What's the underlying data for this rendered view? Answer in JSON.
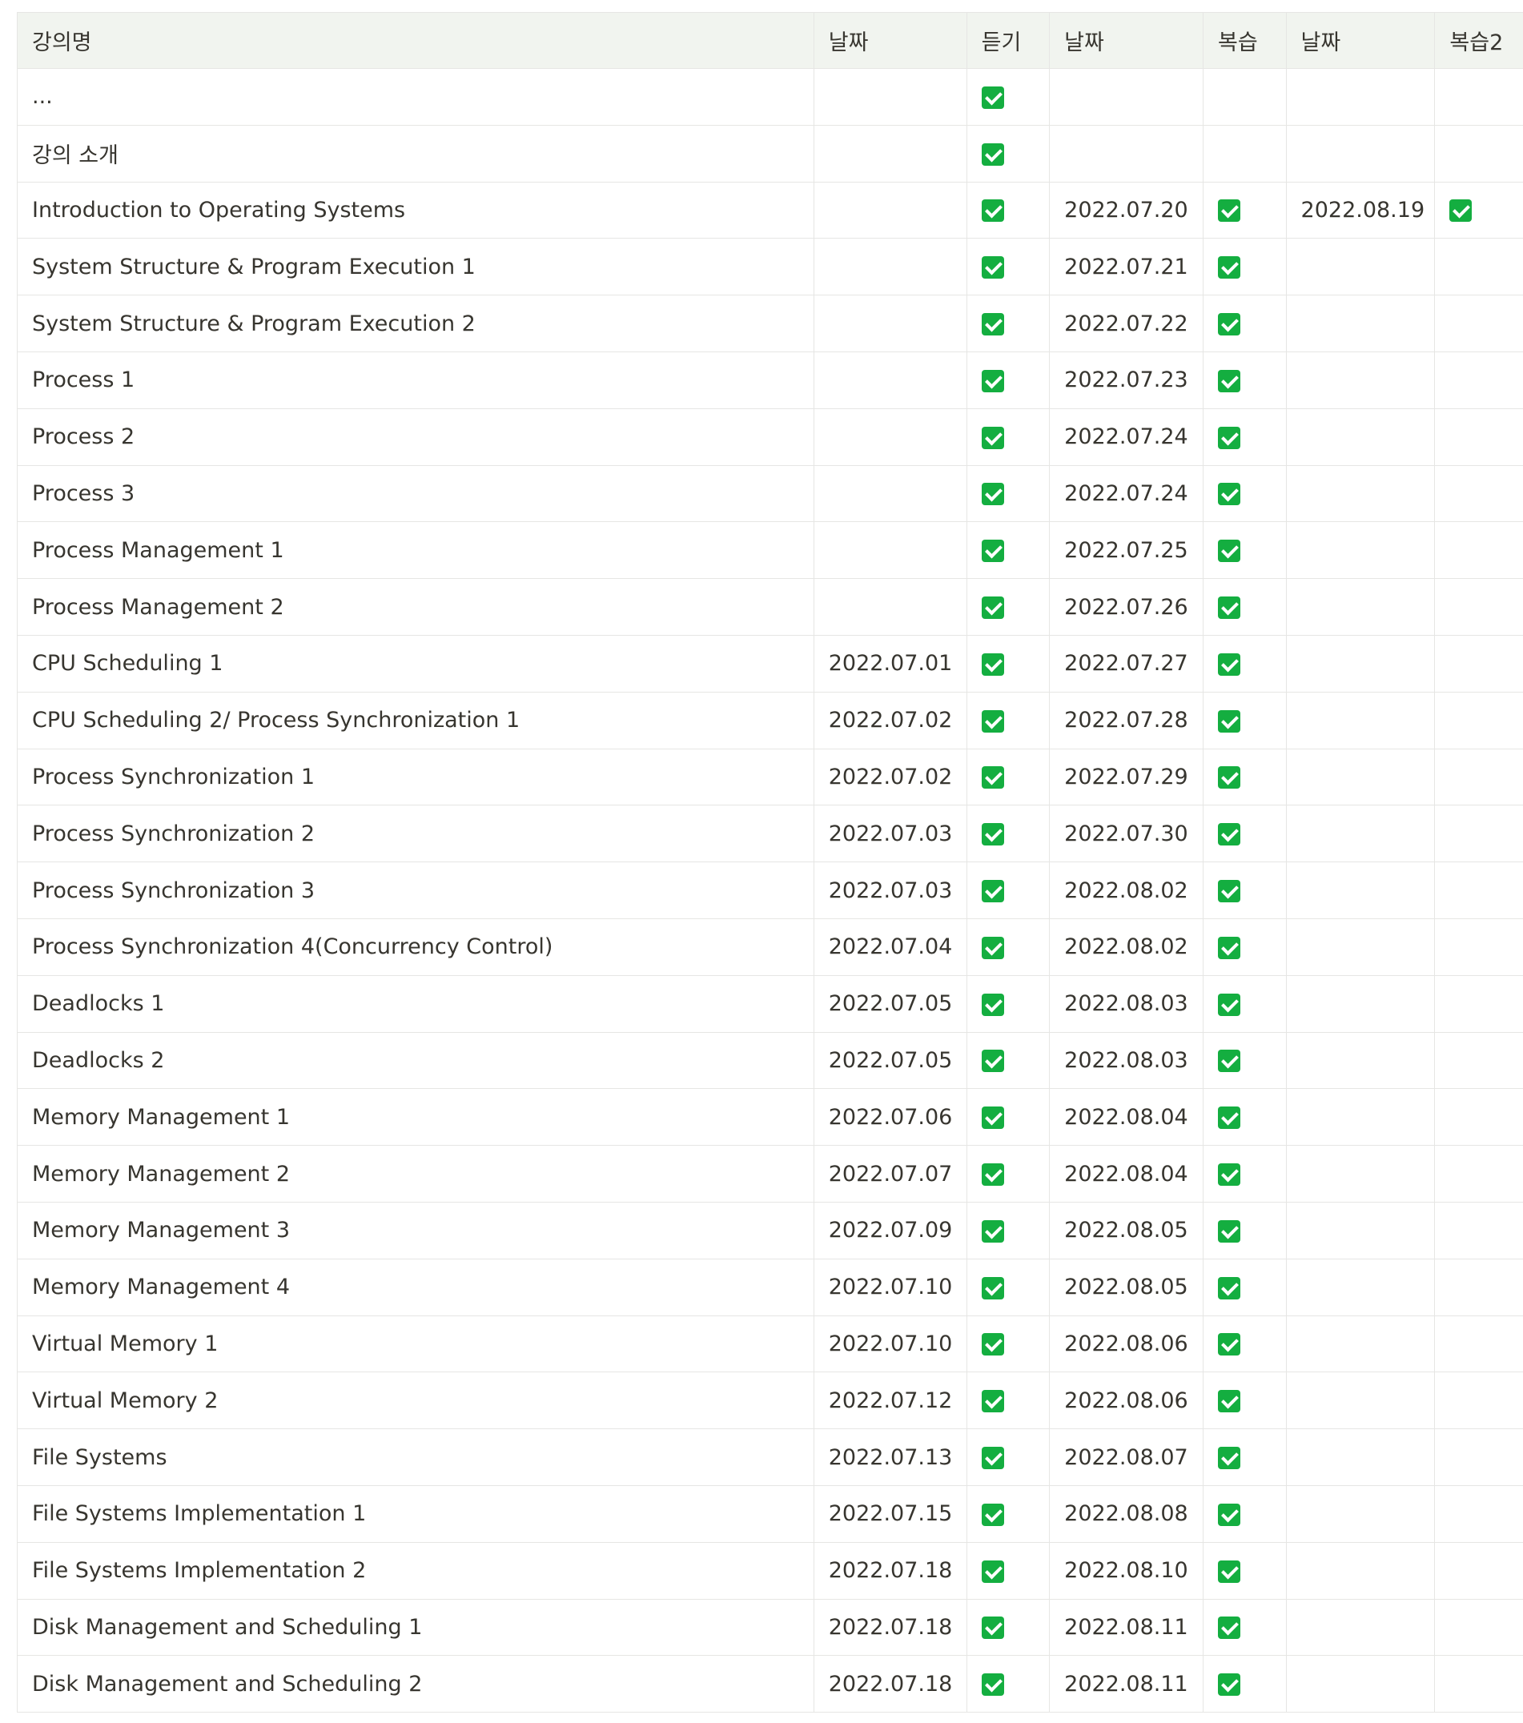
{
  "columns": {
    "lecture": "강의명",
    "date1": "날짜",
    "listen": "듣기",
    "date2": "날짜",
    "review": "복습",
    "date3": "날짜",
    "review2": "복습2"
  },
  "rows": [
    {
      "lecture": "...",
      "date1": "",
      "listen": true,
      "date2": "",
      "review": false,
      "date3": "",
      "review2": false
    },
    {
      "lecture": "강의 소개",
      "date1": "",
      "listen": true,
      "date2": "",
      "review": false,
      "date3": "",
      "review2": false
    },
    {
      "lecture": "Introduction to Operating Systems",
      "date1": "",
      "listen": true,
      "date2": "2022.07.20",
      "review": true,
      "date3": "2022.08.19",
      "review2": true
    },
    {
      "lecture": "System Structure & Program Execution 1",
      "date1": "",
      "listen": true,
      "date2": "2022.07.21",
      "review": true,
      "date3": "",
      "review2": false
    },
    {
      "lecture": "System Structure & Program Execution 2",
      "date1": "",
      "listen": true,
      "date2": "2022.07.22",
      "review": true,
      "date3": "",
      "review2": false
    },
    {
      "lecture": "Process 1",
      "date1": "",
      "listen": true,
      "date2": "2022.07.23",
      "review": true,
      "date3": "",
      "review2": false
    },
    {
      "lecture": "Process 2",
      "date1": "",
      "listen": true,
      "date2": "2022.07.24",
      "review": true,
      "date3": "",
      "review2": false
    },
    {
      "lecture": "Process 3",
      "date1": "",
      "listen": true,
      "date2": "2022.07.24",
      "review": true,
      "date3": "",
      "review2": false
    },
    {
      "lecture": "Process Management 1",
      "date1": "",
      "listen": true,
      "date2": "2022.07.25",
      "review": true,
      "date3": "",
      "review2": false
    },
    {
      "lecture": "Process Management 2",
      "date1": "",
      "listen": true,
      "date2": "2022.07.26",
      "review": true,
      "date3": "",
      "review2": false
    },
    {
      "lecture": "CPU Scheduling 1",
      "date1": "2022.07.01",
      "listen": true,
      "date2": "2022.07.27",
      "review": true,
      "date3": "",
      "review2": false
    },
    {
      "lecture": "CPU Scheduling 2/ Process Synchronization 1",
      "date1": "2022.07.02",
      "listen": true,
      "date2": "2022.07.28",
      "review": true,
      "date3": "",
      "review2": false
    },
    {
      "lecture": "Process Synchronization 1",
      "date1": "2022.07.02",
      "listen": true,
      "date2": "2022.07.29",
      "review": true,
      "date3": "",
      "review2": false
    },
    {
      "lecture": "Process Synchronization 2",
      "date1": "2022.07.03",
      "listen": true,
      "date2": "2022.07.30",
      "review": true,
      "date3": "",
      "review2": false
    },
    {
      "lecture": "Process Synchronization 3",
      "date1": "2022.07.03",
      "listen": true,
      "date2": "2022.08.02",
      "review": true,
      "date3": "",
      "review2": false
    },
    {
      "lecture": "Process Synchronization 4(Concurrency Control)",
      "date1": "2022.07.04",
      "listen": true,
      "date2": "2022.08.02",
      "review": true,
      "date3": "",
      "review2": false
    },
    {
      "lecture": "Deadlocks 1",
      "date1": "2022.07.05",
      "listen": true,
      "date2": "2022.08.03",
      "review": true,
      "date3": "",
      "review2": false
    },
    {
      "lecture": "Deadlocks 2",
      "date1": "2022.07.05",
      "listen": true,
      "date2": "2022.08.03",
      "review": true,
      "date3": "",
      "review2": false
    },
    {
      "lecture": "Memory Management 1",
      "date1": "2022.07.06",
      "listen": true,
      "date2": "2022.08.04",
      "review": true,
      "date3": "",
      "review2": false
    },
    {
      "lecture": "Memory Management 2",
      "date1": "2022.07.07",
      "listen": true,
      "date2": "2022.08.04",
      "review": true,
      "date3": "",
      "review2": false
    },
    {
      "lecture": "Memory Management 3",
      "date1": "2022.07.09",
      "listen": true,
      "date2": "2022.08.05",
      "review": true,
      "date3": "",
      "review2": false
    },
    {
      "lecture": "Memory Management 4",
      "date1": "2022.07.10",
      "listen": true,
      "date2": "2022.08.05",
      "review": true,
      "date3": "",
      "review2": false
    },
    {
      "lecture": "Virtual Memory 1",
      "date1": "2022.07.10",
      "listen": true,
      "date2": "2022.08.06",
      "review": true,
      "date3": "",
      "review2": false
    },
    {
      "lecture": "Virtual Memory 2",
      "date1": "2022.07.12",
      "listen": true,
      "date2": "2022.08.06",
      "review": true,
      "date3": "",
      "review2": false
    },
    {
      "lecture": "File Systems",
      "date1": "2022.07.13",
      "listen": true,
      "date2": "2022.08.07",
      "review": true,
      "date3": "",
      "review2": false
    },
    {
      "lecture": "File Systems Implementation 1",
      "date1": "2022.07.15",
      "listen": true,
      "date2": "2022.08.08",
      "review": true,
      "date3": "",
      "review2": false
    },
    {
      "lecture": "File Systems Implementation 2",
      "date1": "2022.07.18",
      "listen": true,
      "date2": "2022.08.10",
      "review": true,
      "date3": "",
      "review2": false
    },
    {
      "lecture": "Disk Management and Scheduling 1",
      "date1": "2022.07.18",
      "listen": true,
      "date2": "2022.08.11",
      "review": true,
      "date3": "",
      "review2": false
    },
    {
      "lecture": "Disk Management and Scheduling 2",
      "date1": "2022.07.18",
      "listen": true,
      "date2": "2022.08.11",
      "review": true,
      "date3": "",
      "review2": false
    }
  ],
  "icons": {
    "check": "check-box-icon"
  },
  "colors": {
    "header_bg": "#f1f4ef",
    "border": "#e6e6e4",
    "check_green": "#14ae40",
    "text": "#37352f"
  }
}
